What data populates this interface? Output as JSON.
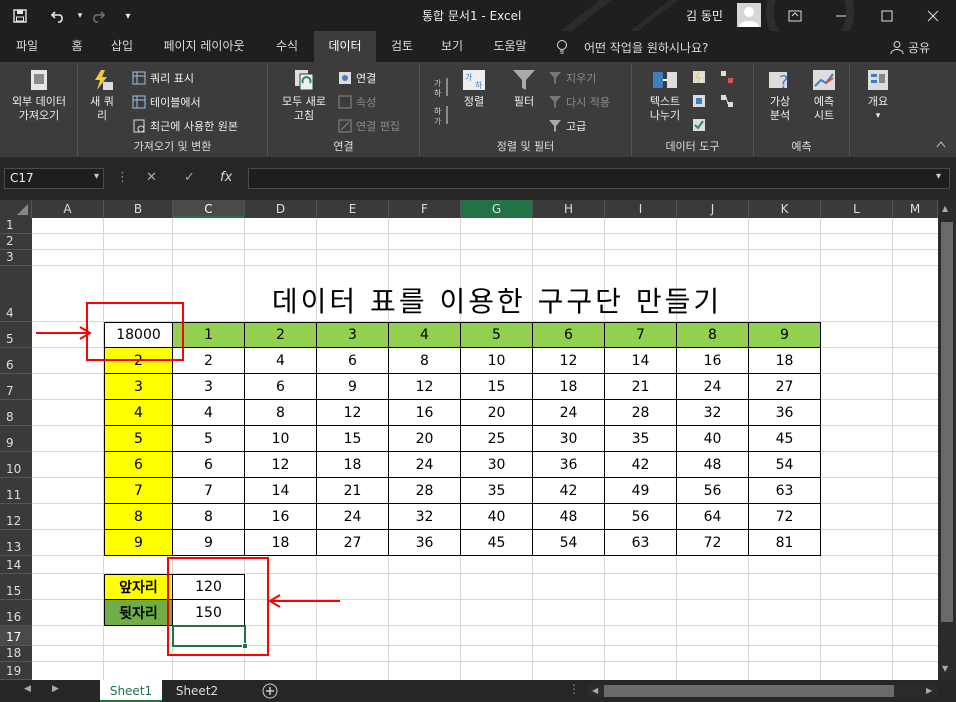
{
  "titlebar": {
    "doc_title": "통합 문서1  -  Excel",
    "user_name": "김 동민",
    "qat_customize": "▾"
  },
  "tabs": [
    {
      "label": "파일"
    },
    {
      "label": "홈"
    },
    {
      "label": "삽입"
    },
    {
      "label": "페이지 레이아웃"
    },
    {
      "label": "수식"
    },
    {
      "label": "데이터"
    },
    {
      "label": "검토"
    },
    {
      "label": "보기"
    },
    {
      "label": "도움말"
    }
  ],
  "tell_me": "어떤 작업을 원하시나요?",
  "share": "공유",
  "ribbon": {
    "get_external": "외부 데이터\n가져오기",
    "new_query": "새 쿼\n리",
    "show_query": "쿼리 표시",
    "from_table": "테이블에서",
    "recent_sources": "최근에 사용한 원본",
    "group_transform": "가져오기 및 변환",
    "refresh_all": "모두 새로\n고침",
    "connections": "연결",
    "properties": "속성",
    "edit_links": "연결 편집",
    "group_connections": "연결",
    "sort": "정렬",
    "filter": "필터",
    "clear": "지우기",
    "reapply": "다시 적용",
    "advanced": "고급",
    "group_sort_filter": "정렬 및 필터",
    "text_to_columns": "텍스트\n나누기",
    "group_data_tools": "데이터 도구",
    "what_if": "가상\n분석",
    "forecast_sheet": "예측\n시트",
    "group_forecast": "예측",
    "outline": "개요"
  },
  "formula_bar": {
    "name_box": "C17",
    "formula": ""
  },
  "columns": [
    "A",
    "B",
    "C",
    "D",
    "E",
    "F",
    "G",
    "H",
    "I",
    "J",
    "K",
    "L",
    "M"
  ],
  "rows": [
    "1",
    "2",
    "3",
    "4",
    "5",
    "6",
    "7",
    "8",
    "9",
    "10",
    "11",
    "12",
    "13",
    "14",
    "15",
    "16",
    "17",
    "18",
    "19"
  ],
  "sheet": {
    "title": "데이터 표를 이용한 구구단 만들기",
    "corner_value": "18000",
    "header_row": [
      "1",
      "2",
      "3",
      "4",
      "5",
      "6",
      "7",
      "8",
      "9"
    ],
    "row_labels": [
      "2",
      "3",
      "4",
      "5",
      "6",
      "7",
      "8",
      "9"
    ],
    "table": [
      [
        "2",
        "4",
        "6",
        "8",
        "10",
        "12",
        "14",
        "16",
        "18"
      ],
      [
        "3",
        "6",
        "9",
        "12",
        "15",
        "18",
        "21",
        "24",
        "27"
      ],
      [
        "4",
        "8",
        "12",
        "16",
        "20",
        "24",
        "28",
        "32",
        "36"
      ],
      [
        "5",
        "10",
        "15",
        "20",
        "25",
        "30",
        "35",
        "40",
        "45"
      ],
      [
        "6",
        "12",
        "18",
        "24",
        "30",
        "36",
        "42",
        "48",
        "54"
      ],
      [
        "7",
        "14",
        "21",
        "28",
        "35",
        "42",
        "49",
        "56",
        "63"
      ],
      [
        "8",
        "16",
        "24",
        "32",
        "40",
        "48",
        "56",
        "64",
        "72"
      ],
      [
        "9",
        "18",
        "27",
        "36",
        "45",
        "54",
        "63",
        "72",
        "81"
      ]
    ],
    "front_label": "앞자리",
    "front_value": "120",
    "back_label": "뒷자리",
    "back_value": "150"
  },
  "sheet_tabs": [
    "Sheet1",
    "Sheet2"
  ],
  "colors": {
    "green_header": "#92d050",
    "yellow": "#ffff00",
    "back_label_green": "#70ad47",
    "annotation_red": "#ff0000",
    "excel_green": "#217346"
  }
}
